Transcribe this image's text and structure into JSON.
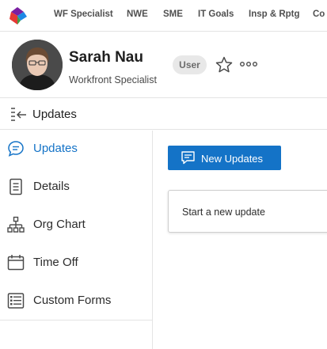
{
  "nav": {
    "items": [
      "WF Specialist",
      "NWE",
      "SME",
      "IT Goals",
      "Insp & Rptg",
      "Co"
    ]
  },
  "profile": {
    "name": "Sarah Nau",
    "role": "Workfront Specialist",
    "badge": "User"
  },
  "section": {
    "title": "Updates"
  },
  "sidebar": {
    "items": [
      {
        "label": "Updates",
        "icon": "chat-bubble-icon",
        "active": true
      },
      {
        "label": "Details",
        "icon": "document-icon",
        "active": false
      },
      {
        "label": "Org Chart",
        "icon": "org-chart-icon",
        "active": false
      },
      {
        "label": "Time Off",
        "icon": "calendar-icon",
        "active": false
      },
      {
        "label": "Custom Forms",
        "icon": "form-icon",
        "active": false
      }
    ]
  },
  "main": {
    "new_update_label": "New Updates",
    "new_update_placeholder": "Start a new update"
  },
  "colors": {
    "accent": "#1473c7",
    "border": "#e4e4e4"
  }
}
